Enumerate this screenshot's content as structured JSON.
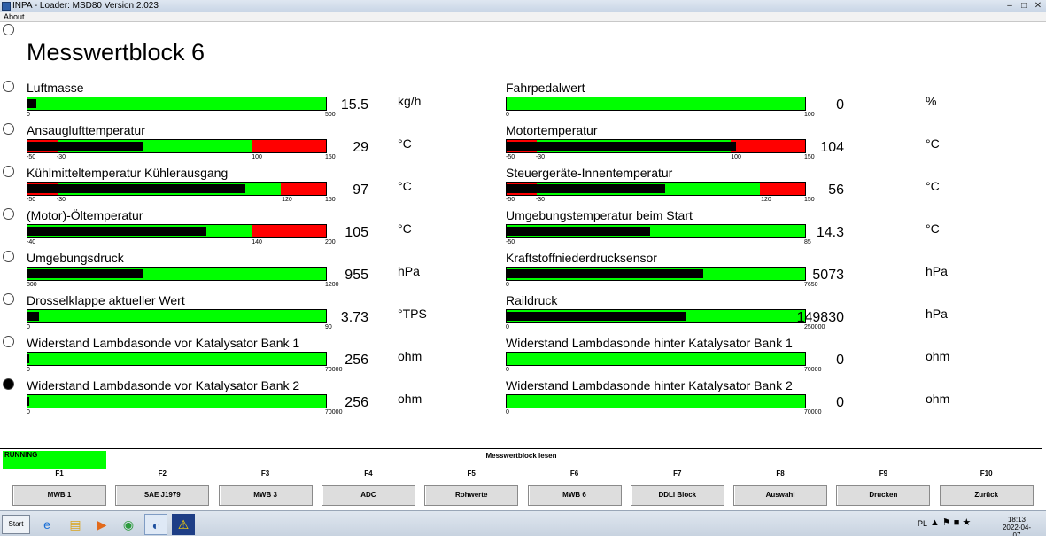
{
  "window": {
    "title": "INPA - Loader: MSD80 Version 2.023",
    "menu_about": "About..."
  },
  "heading": "Messwertblock 6",
  "left_items": [
    {
      "label": "Luftmasse",
      "value": "15.5",
      "unit": "kg/h",
      "ticks": [
        "0",
        "500"
      ],
      "fill_fraction": 0.03,
      "red_segments": []
    },
    {
      "label": "Ansauglufttemperatur",
      "value": "29",
      "unit": "°C",
      "ticks": [
        "-50",
        "-30",
        "100",
        "150"
      ],
      "fill_fraction": 0.39,
      "red_segments": [
        "-50..-30",
        "100..150"
      ]
    },
    {
      "label": "Kühlmitteltemperatur Kühlerausgang",
      "value": "97",
      "unit": "°C",
      "ticks": [
        "-50",
        "-30",
        "120",
        "150"
      ],
      "fill_fraction": 0.73,
      "red_segments": [
        "-50..-30",
        "120..150"
      ]
    },
    {
      "label": "(Motor)-Öltemperatur",
      "value": "105",
      "unit": "°C",
      "ticks": [
        "-40",
        "140",
        "200"
      ],
      "fill_fraction": 0.6,
      "red_segments": [
        "140..200"
      ]
    },
    {
      "label": "Umgebungsdruck",
      "value": "955",
      "unit": "hPa",
      "ticks": [
        "800",
        "1200"
      ],
      "fill_fraction": 0.39,
      "red_segments": []
    },
    {
      "label": "Drosselklappe aktueller Wert",
      "value": "3.73",
      "unit": "°TPS",
      "ticks": [
        "0",
        "90"
      ],
      "fill_fraction": 0.04,
      "red_segments": []
    },
    {
      "label": "Widerstand Lambdasonde vor Katalysator Bank 1",
      "value": "256",
      "unit": "ohm",
      "ticks": [
        "0",
        "70000"
      ],
      "fill_fraction": 0.004,
      "red_segments": []
    },
    {
      "label": "Widerstand Lambdasonde vor Katalysator Bank 2",
      "value": "256",
      "unit": "ohm",
      "ticks": [
        "0",
        "70000"
      ],
      "fill_fraction": 0.004,
      "red_segments": []
    }
  ],
  "right_items": [
    {
      "label": "Fahrpedalwert",
      "value": "0",
      "unit": "%",
      "ticks": [
        "0",
        "100"
      ],
      "fill_fraction": 0,
      "red_segments": []
    },
    {
      "label": "Motortemperatur",
      "value": "104",
      "unit": "°C",
      "ticks": [
        "-50",
        "-30",
        "100",
        "150"
      ],
      "fill_fraction": 0.77,
      "red_segments": [
        "-50..-30",
        "100..150"
      ]
    },
    {
      "label": "Steuergeräte-Innentemperatur",
      "value": "56",
      "unit": "°C",
      "ticks": [
        "-50",
        "-30",
        "120",
        "150"
      ],
      "fill_fraction": 0.53,
      "red_segments": [
        "-50..-30",
        "120..150"
      ]
    },
    {
      "label": "Umgebungstemperatur beim Start",
      "value": "14.3",
      "unit": "°C",
      "ticks": [
        "-50",
        "85"
      ],
      "fill_fraction": 0.48,
      "red_segments": []
    },
    {
      "label": "Kraftstoffniederdrucksensor",
      "value": "5073",
      "unit": "hPa",
      "ticks": [
        "0",
        "7650"
      ],
      "fill_fraction": 0.66,
      "red_segments": []
    },
    {
      "label": "Raildruck",
      "value": "149830",
      "unit": "hPa",
      "ticks": [
        "0",
        "250000"
      ],
      "fill_fraction": 0.6,
      "red_segments": []
    },
    {
      "label": "Widerstand Lambdasonde hinter Katalysator Bank 1",
      "value": "0",
      "unit": "ohm",
      "ticks": [
        "0",
        "70000"
      ],
      "fill_fraction": 0,
      "red_segments": []
    },
    {
      "label": "Widerstand Lambdasonde hinter Katalysator Bank 2",
      "value": "0",
      "unit": "ohm",
      "ticks": [
        "0",
        "70000"
      ],
      "fill_fraction": 0,
      "red_segments": []
    }
  ],
  "status": {
    "running": "RUNNING",
    "title": "Messwertblock lesen"
  },
  "function_keys": [
    {
      "key": "F1",
      "label": "MWB 1"
    },
    {
      "key": "F2",
      "label": "SAE J1979"
    },
    {
      "key": "F3",
      "label": "MWB 3"
    },
    {
      "key": "F4",
      "label": "ADC"
    },
    {
      "key": "F5",
      "label": "Rohwerte"
    },
    {
      "key": "F6",
      "label": "MWB 6"
    },
    {
      "key": "F7",
      "label": "DDLI Block"
    },
    {
      "key": "F8",
      "label": "Auswahl"
    },
    {
      "key": "F9",
      "label": "Drucken"
    },
    {
      "key": "F10",
      "label": "Zurück"
    }
  ],
  "taskbar": {
    "start_label": "Start",
    "language": "PL",
    "time": "18:13",
    "date": "2022-04-07"
  },
  "colors": {
    "bar_ok": "#00ff00",
    "bar_alarm": "#ff0000",
    "bar_value": "#000000"
  }
}
